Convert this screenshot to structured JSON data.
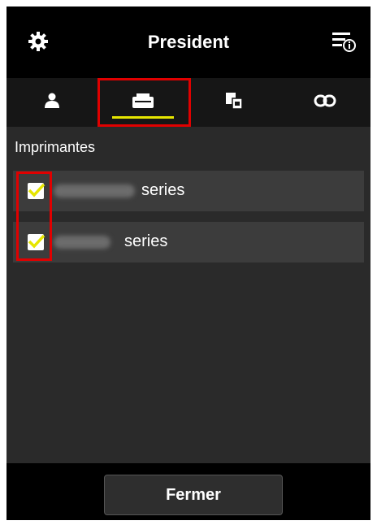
{
  "header": {
    "title": "President"
  },
  "tabs": [
    {
      "name": "user-tab",
      "icon": "user-icon"
    },
    {
      "name": "printer-tab",
      "icon": "printer-icon",
      "active": true
    },
    {
      "name": "documents-tab",
      "icon": "documents-icon"
    },
    {
      "name": "link-tab",
      "icon": "link-icon"
    }
  ],
  "section": {
    "label": "Imprimantes"
  },
  "printers": [
    {
      "label": "series",
      "checked": true
    },
    {
      "label": "series",
      "checked": true
    }
  ],
  "footer": {
    "close_label": "Fermer"
  },
  "colors": {
    "accent": "#e6e600",
    "highlight": "#e00000"
  }
}
